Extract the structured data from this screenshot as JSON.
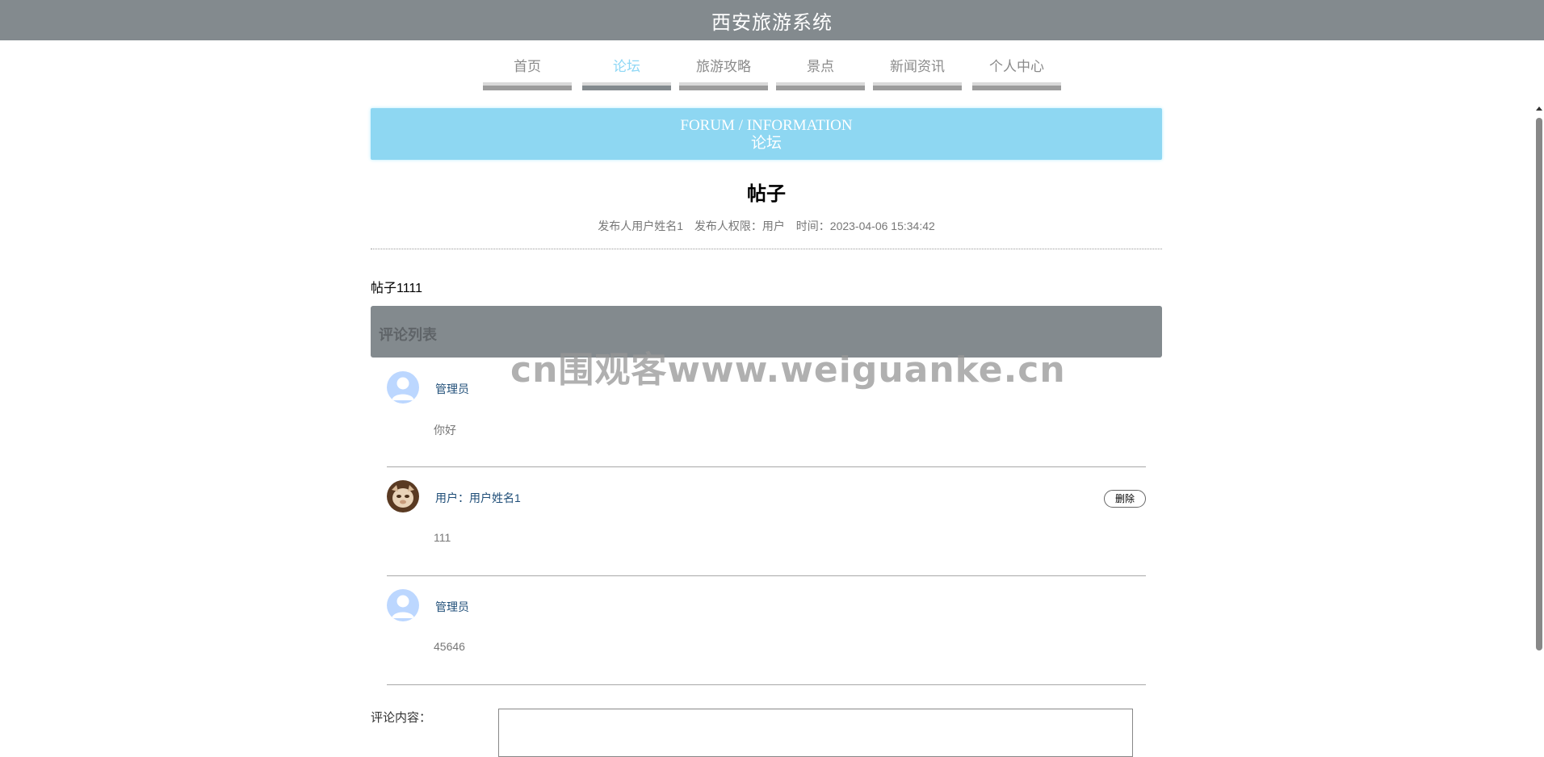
{
  "header": {
    "title": "西安旅游系统"
  },
  "nav": {
    "items": [
      {
        "label": "首页"
      },
      {
        "label": "论坛"
      },
      {
        "label": "旅游攻略"
      },
      {
        "label": "景点"
      },
      {
        "label": "新闻资讯"
      },
      {
        "label": "个人中心"
      }
    ],
    "active_index": 1
  },
  "banner": {
    "en": "FORUM / INFORMATION",
    "cn": "论坛"
  },
  "post": {
    "title": "帖子",
    "publisher": "发布人用户姓名1",
    "role": "发布人权限：用户",
    "time": "时间：2023-04-06 15:34:42",
    "content": "帖子1111"
  },
  "comments_section": {
    "title": "评论列表"
  },
  "comments": [
    {
      "author": "管理员",
      "body": "你好",
      "avatar": "default-avatar-icon",
      "deletable": false
    },
    {
      "author": "用户：用户姓名1",
      "body": "111",
      "avatar": "user-photo-avatar",
      "deletable": true,
      "delete_label": "删除"
    },
    {
      "author": "管理员",
      "body": "45646",
      "avatar": "default-avatar-icon",
      "deletable": false
    }
  ],
  "comment_form": {
    "label": "评论内容：",
    "value": ""
  },
  "watermark": "cn围观客www.weiguanke.cn",
  "colors": {
    "header_bg": "#838a8e",
    "banner_bg": "#8ed7f2",
    "active_nav": "#8ed7f5",
    "author_text": "#1f4e78"
  }
}
